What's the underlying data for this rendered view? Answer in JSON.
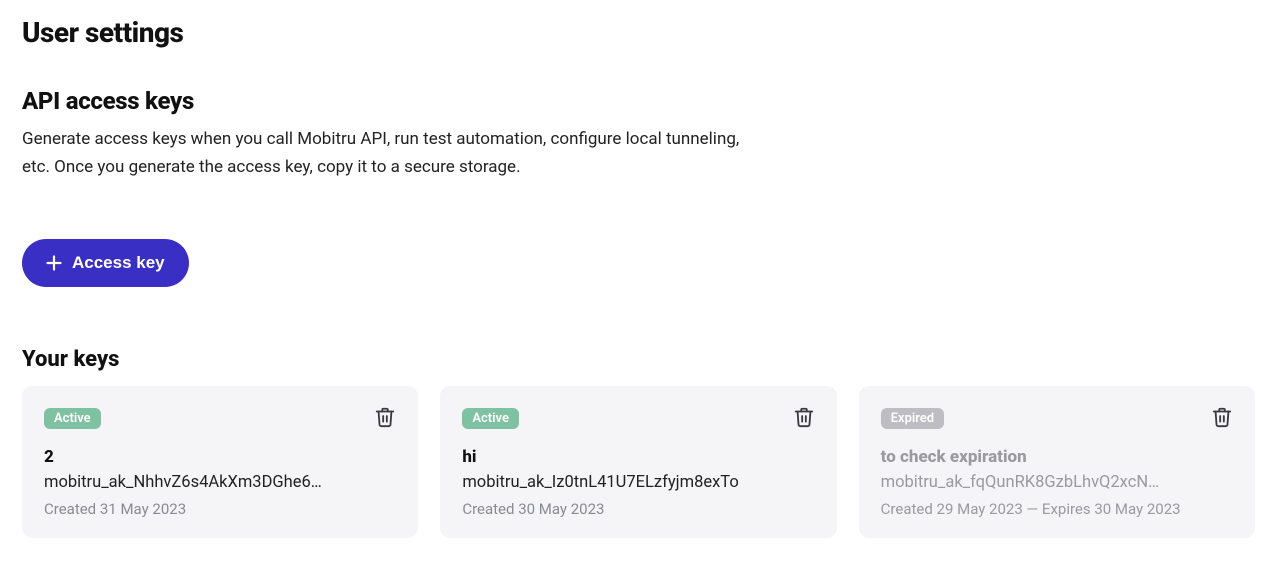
{
  "page_title": "User settings",
  "section_title": "API access keys",
  "description": "Generate access keys when you call Mobitru API, run test automation, configure local tunneling, etc. Once you generate the access key, copy it to a secure storage.",
  "create_button_label": "Access key",
  "your_keys_title": "Your keys",
  "status_labels": {
    "active": "Active",
    "expired": "Expired"
  },
  "keys": [
    {
      "status": "active",
      "name": "2",
      "value": "mobitru_ak_NhhvZ6s4AkXm3DGhe6…",
      "meta": "Created 31 May 2023"
    },
    {
      "status": "active",
      "name": "hi",
      "value": "mobitru_ak_Iz0tnL41U7ELzfyjm8exTo",
      "meta": "Created 30 May 2023"
    },
    {
      "status": "expired",
      "name": "to check expiration",
      "value": "mobitru_ak_fqQunRK8GzbLhvQ2xcN…",
      "meta": "Created 29 May 2023 — Expires 30 May 2023"
    }
  ]
}
